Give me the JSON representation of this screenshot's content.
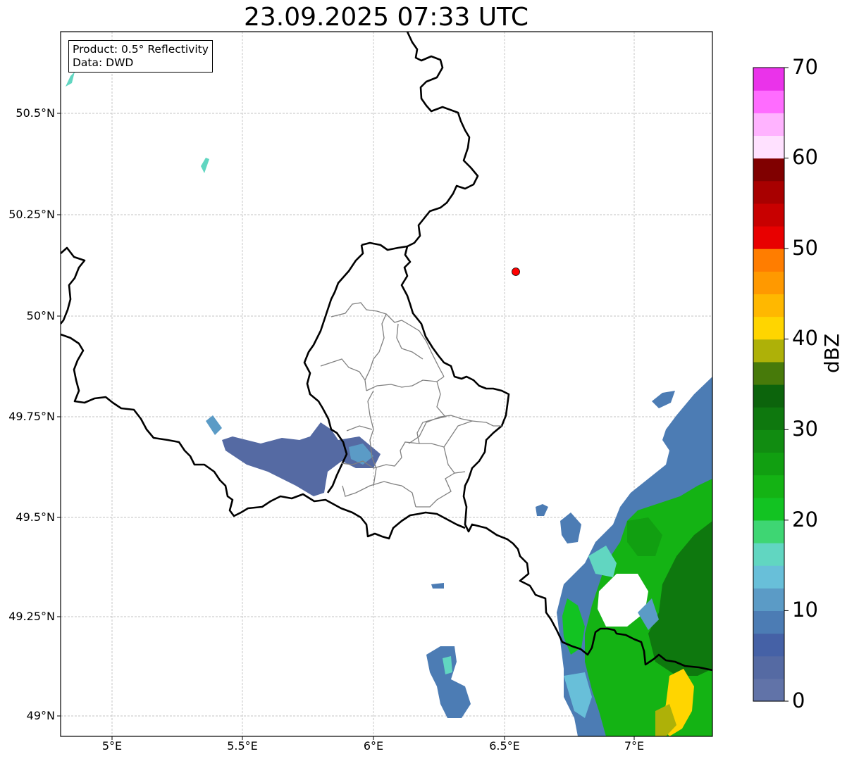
{
  "title": "23.09.2025 07:33 UTC",
  "info": {
    "product_line": "Product: 0.5° Reflectivity",
    "data_line": "Data: DWD"
  },
  "map": {
    "lon_range": [
      4.8,
      7.3
    ],
    "lat_range": [
      48.95,
      50.7
    ],
    "lat_ticks": [
      "50.5°N",
      "50.25°N",
      "50°N",
      "49.75°N",
      "49.5°N",
      "49.25°N",
      "49°N"
    ],
    "lon_ticks": [
      "5°E",
      "5.5°E",
      "6°E",
      "6.5°E",
      "7°E"
    ],
    "gridlines": "on",
    "marker": {
      "lon": 6.55,
      "lat": 50.11,
      "color": "#ff0000"
    }
  },
  "colorbar": {
    "unit": "dBZ",
    "tick_labels": [
      "0",
      "10",
      "20",
      "30",
      "40",
      "50",
      "60",
      "70"
    ],
    "colors": [
      "#6173a8",
      "#556aa3",
      "#4561a6",
      "#4c7cb4",
      "#5b9bc6",
      "#68bfd9",
      "#61d6c1",
      "#3ed673",
      "#12c322",
      "#14b314",
      "#119f11",
      "#118c11",
      "#0e780e",
      "#0c640c",
      "#477a0a",
      "#aeb108",
      "#ffd500",
      "#ffb800",
      "#ff9900",
      "#ff7d00",
      "#e80000",
      "#c80000",
      "#a80000",
      "#800000",
      "#ffe1ff",
      "#ffb3ff",
      "#ff6cff",
      "#ea33ea"
    ]
  }
}
